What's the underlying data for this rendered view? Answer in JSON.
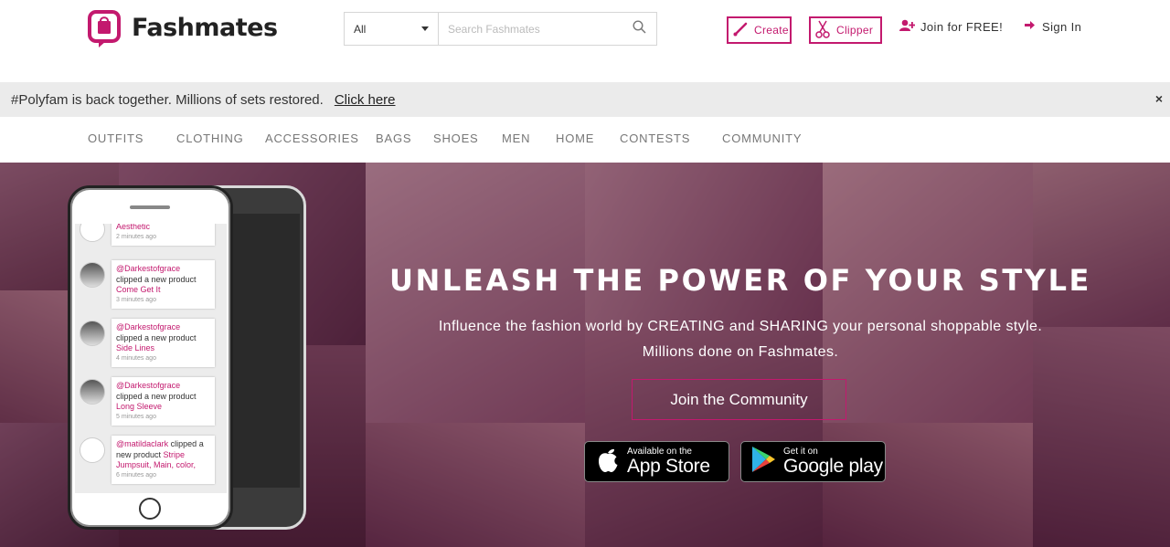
{
  "brand": {
    "name": "Fashmates",
    "accent": "#c3196e"
  },
  "search": {
    "category": "All",
    "placeholder": "Search Fashmates"
  },
  "header": {
    "create_label": "Create",
    "clipper_label": "Clipper",
    "join_label": "Join for FREE!",
    "signin_label": "Sign In"
  },
  "notice": {
    "text": "#Polyfam is back together. Millions of sets restored.",
    "link": "Click here",
    "close": "×"
  },
  "nav": [
    "OUTFITS",
    "CLOTHING",
    "ACCESSORIES",
    "BAGS",
    "SHOES",
    "MEN",
    "HOME",
    "CONTESTS",
    "COMMUNITY"
  ],
  "hero": {
    "title": "UNLEASH THE POWER OF YOUR STYLE",
    "subtitle_line1": "Influence the fashion world by CREATING and SHARING your personal shoppable style.",
    "subtitle_line2": "Millions done on Fashmates.",
    "cta": "Join the Community",
    "appstore_small": "Available on the",
    "appstore_big": "App Store",
    "google_small": "Get it on",
    "google_big": "Google play"
  },
  "feed": [
    {
      "user": "",
      "action": "",
      "product": "Aesthetic",
      "time": "2 minutes ago"
    },
    {
      "user": "@Darkestofgrace",
      "action": "clipped a new product",
      "product": "Come Get It",
      "time": "3 minutes ago"
    },
    {
      "user": "@Darkestofgrace",
      "action": "clipped a new product",
      "product": "Side Lines",
      "time": "4 minutes ago"
    },
    {
      "user": "@Darkestofgrace",
      "action": "clipped a new product",
      "product": "Long Sleeve",
      "time": "5 minutes ago"
    },
    {
      "user": "@matildaclark",
      "action": "clipped a new product",
      "product": "Stripe Jumpsuit, Main, color,",
      "time": "6 minutes ago"
    }
  ]
}
